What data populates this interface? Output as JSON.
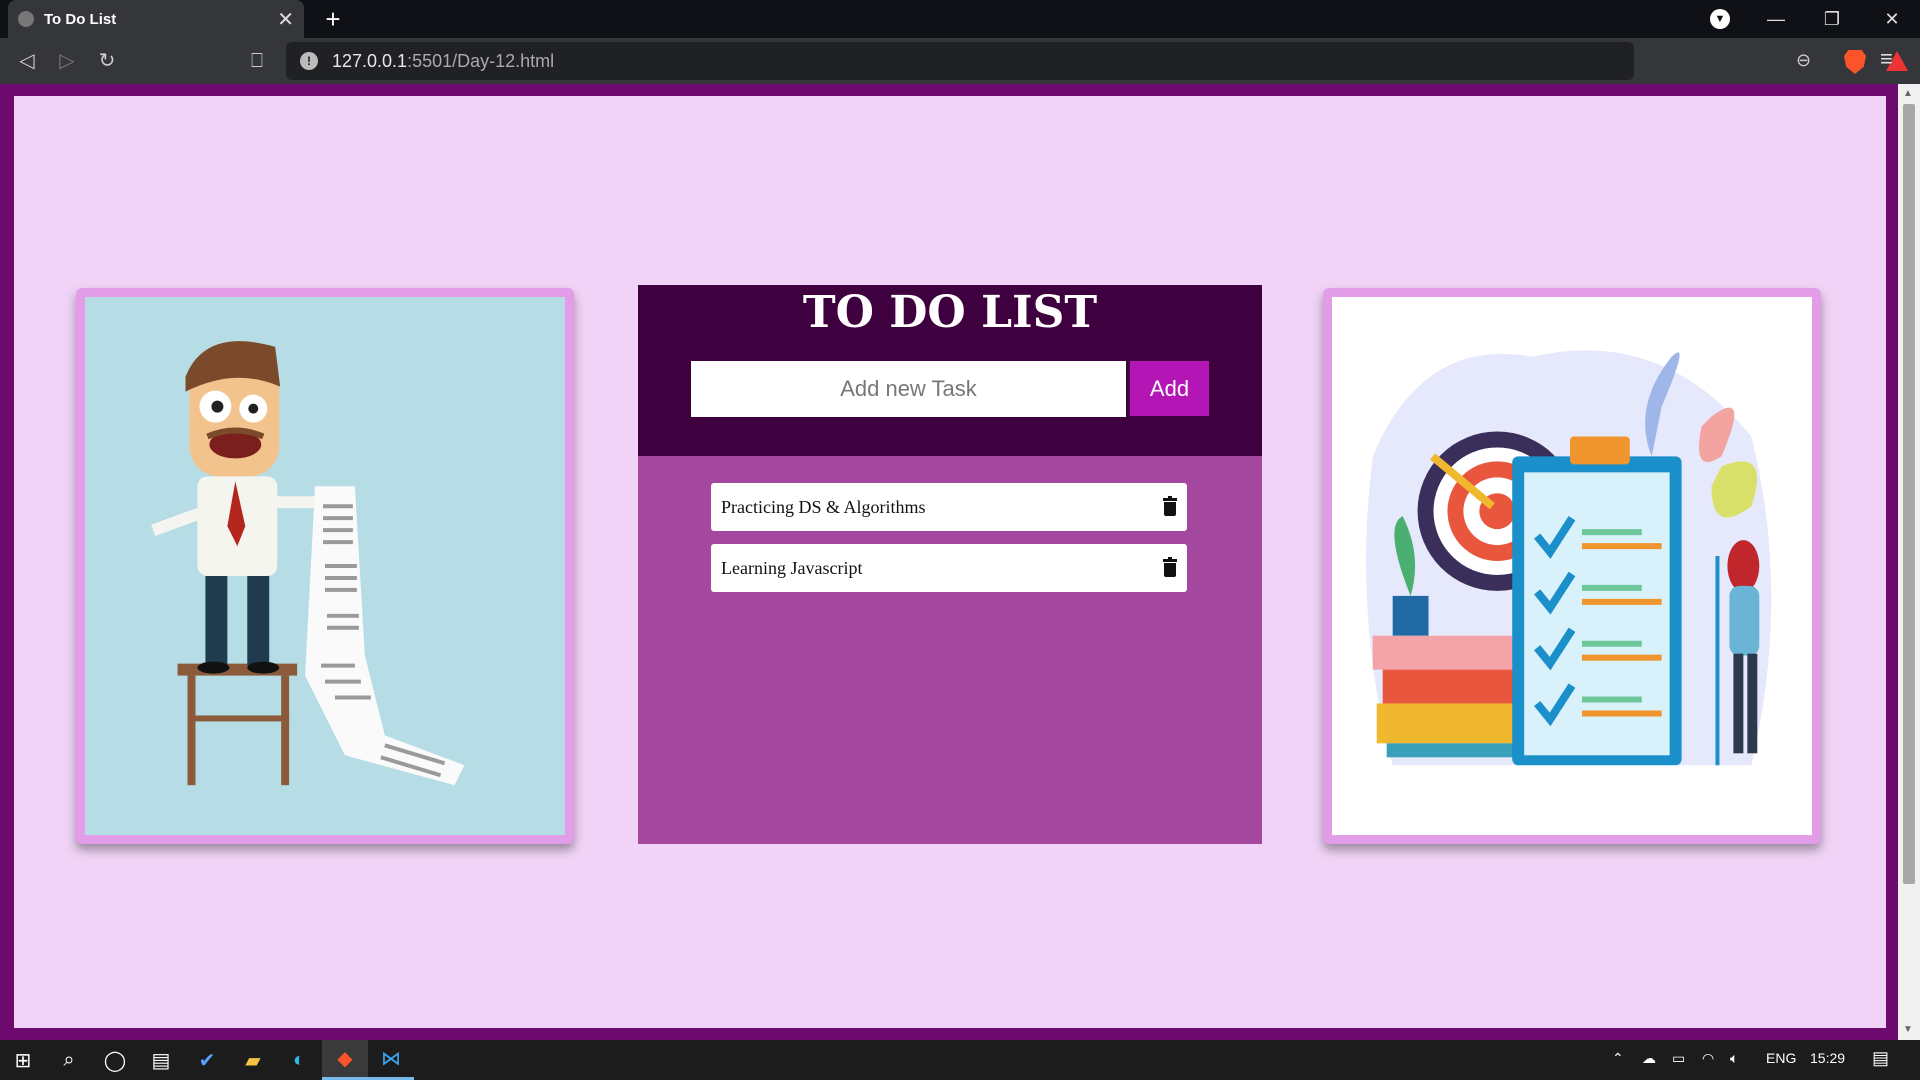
{
  "browser": {
    "tab_title": "To Do List",
    "tab_close": "✕",
    "new_tab": "+",
    "url_host": "127.0.0.1",
    "url_rest": ":5501/Day-12.html"
  },
  "todo": {
    "title": "TO DO LIST",
    "input_placeholder": "Add new Task",
    "add_label": "Add",
    "tasks": [
      {
        "text": "Practicing DS & Algorithms"
      },
      {
        "text": "Learning Javascript"
      }
    ]
  },
  "taskbar": {
    "lang": "ENG",
    "time": "15:29"
  },
  "colors": {
    "page_bg": "#f0d3f6",
    "header_bg": "#3f003f",
    "panel_bg": "#a4479f",
    "add_button": "#b415b5",
    "frame_border": "#e29ce8"
  }
}
